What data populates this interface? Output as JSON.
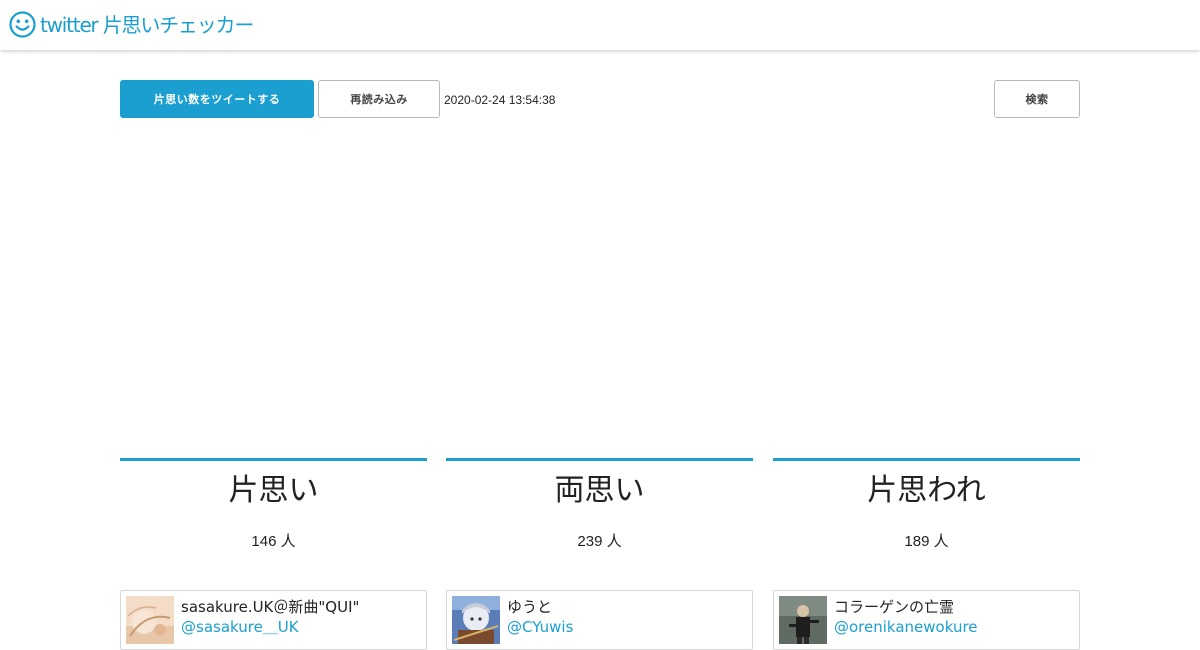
{
  "header": {
    "brand_icon": "smiley-icon",
    "title": "twitter 片思いチェッカー",
    "accent": "#1a9fd0"
  },
  "toolbar": {
    "tweet_label": "片思い数をツイートする",
    "reload_label": "再読み込み",
    "timestamp": "2020-02-24 13:54:38",
    "search_label": "検索"
  },
  "columns": [
    {
      "title": "片思い",
      "count": "146 人",
      "first_user": {
        "name": "sasakure.UK＠新曲\"QUI\"",
        "handle": "@sasakure＿UK"
      }
    },
    {
      "title": "両思い",
      "count": "239 人",
      "first_user": {
        "name": "ゆうと",
        "handle": "@CYuwis"
      }
    },
    {
      "title": "片思われ",
      "count": "189 人",
      "first_user": {
        "name": "コラーゲンの亡霊",
        "handle": "@orenikanewokure"
      }
    }
  ]
}
